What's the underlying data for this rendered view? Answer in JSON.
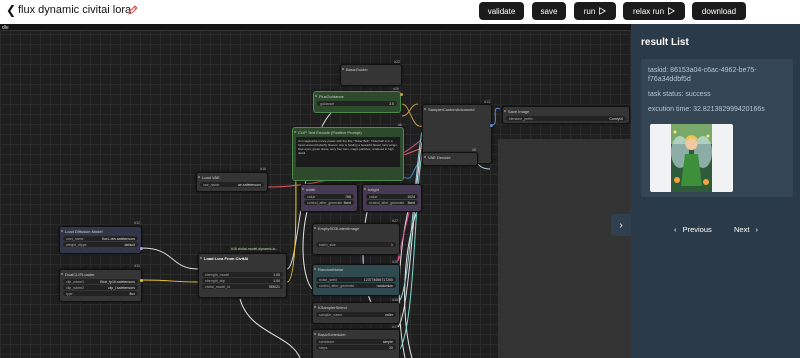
{
  "header": {
    "title": "flux dynamic civitai lora",
    "buttons": {
      "validate": "validate",
      "save": "save",
      "run": "run",
      "relax_run": "relax run",
      "download": "download"
    }
  },
  "canvas": {
    "tab_label": "dle",
    "nodes": {
      "basic_guider": {
        "title": "BasicGuider",
        "id": "#22"
      },
      "flux_guidance": {
        "title": "FluxGuidance",
        "id": "#26",
        "field_label": "guidance",
        "field_value": "3.5"
      },
      "sampler_custom": {
        "title": "SamplerCustomAdvanced",
        "id": "#13"
      },
      "save_image": {
        "title": "Save Image",
        "field_label": "filename_prefix",
        "field_value": "ComfyUI"
      },
      "clip_text_encode": {
        "title": "CLIP Text Encode (Positive Prompt)",
        "id": "#6",
        "text": "An imaginative movie poster with the title \"Tinker Bell\". Tinkerbell is in a forest around butterfly flowers, she is holding a beautiful flower, fairy wings, blue eyes, green dress, sexy four toes, magic particles, rendered in high detail"
      },
      "vae_decode": {
        "title": "VAE Decode",
        "id": "#8"
      },
      "load_vae": {
        "title": "Load VAE",
        "id": "#10",
        "field_label": "vae_name",
        "field_value": "ae.safetensors"
      },
      "width": {
        "title": "width",
        "id": "#27",
        "field_label": "value",
        "field_value": "768",
        "field2_label": "control_after_generate",
        "field2_value": "fixed"
      },
      "height": {
        "title": "height",
        "id": "#28",
        "field_label": "value",
        "field_value": "1024",
        "field2_label": "control_after_generate",
        "field2_value": "fixed"
      },
      "empty_latent": {
        "title": "EmptySD3LatentImage",
        "id": "#27",
        "field_label": "batch_size",
        "field_value": "1"
      },
      "load_diffusion": {
        "title": "Load Diffusion Model",
        "id": "#12",
        "field_label": "unet_name",
        "field_value": "flux1-dev.safetensors",
        "field2_label": "weight_dtype",
        "field2_value": "default"
      },
      "dual_clip": {
        "title": "DualCLIPLoader",
        "id": "#11",
        "field_label": "clip_name1",
        "field_value": "t5xxl_fp16.safetensors",
        "field2_label": "clip_name2",
        "field2_value": "clip_l.safetensors",
        "field3_label": "type",
        "field3_value": "flux"
      },
      "load_lora": {
        "title": "Load Lora From CivitAI",
        "badge": "#16 civitai-model-dynamic-lo...",
        "field_label": "strength_model",
        "field_value": "1.00",
        "field2_label": "strength_clip",
        "field2_value": "1.00",
        "field3_label": "civitai_model_id",
        "field3_value": "785021"
      },
      "random_noise": {
        "title": "RandomNoise",
        "id": "#25",
        "field_label": "noise_seed",
        "field_value": "123774656717200",
        "field2_label": "control_after_generate",
        "field2_value": "randomize"
      },
      "ksampler_select": {
        "title": "KSamplerSelect",
        "id": "#16",
        "field_label": "sampler_name",
        "field_value": "euler"
      },
      "basic_scheduler": {
        "title": "BasicScheduler",
        "id": "#17",
        "field_label": "scheduler",
        "field_value": "simple",
        "field2_label": "steps",
        "field2_value": "20"
      }
    }
  },
  "sidebar": {
    "title": "result List",
    "taskid_line1": "taskid: 86153a04-c6ac-4962-be75-",
    "taskid_line2": "f76a34ddbf5d",
    "task_status": "task status: success",
    "excution_time": "excution time: 32.821382999420166s",
    "previous_label": "Previous",
    "next_label": "Next"
  },
  "colors": {
    "canvas_bg": "#1f1f1f",
    "sidebar_bg": "#2b3a48",
    "card_bg": "#344554",
    "button_bg": "#1b1b1b",
    "edit_icon": "#e05050"
  }
}
